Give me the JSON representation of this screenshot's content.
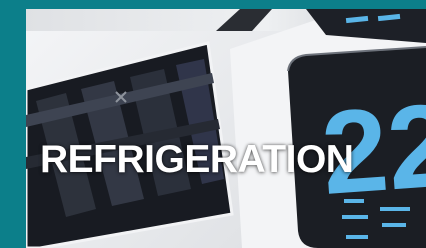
{
  "caption": {
    "text": "REFRIGERATION"
  },
  "thermostat": {
    "display_digits": "22"
  },
  "colors": {
    "frame_teal": "#0c7f8a",
    "display_blue": "#5ab5e8",
    "panel_dark": "#1b1e24"
  }
}
